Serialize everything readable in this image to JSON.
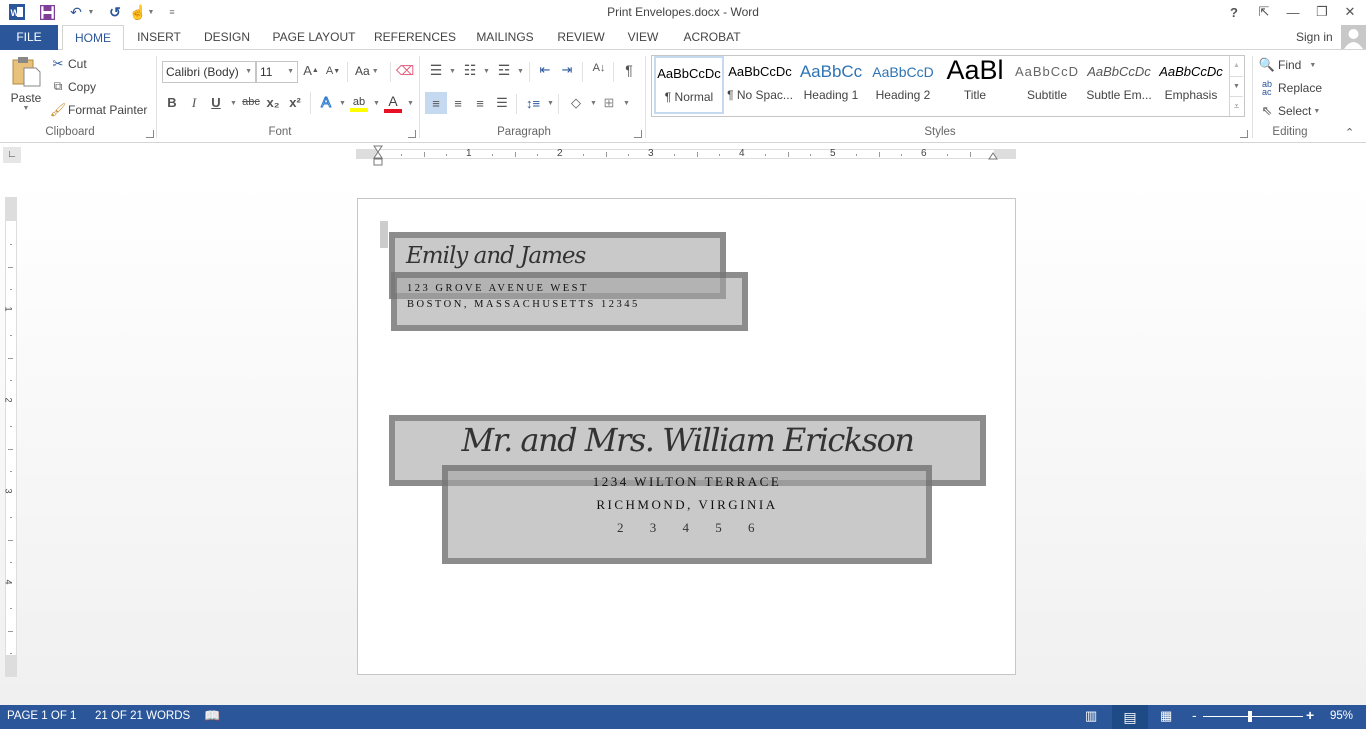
{
  "app": {
    "window_title": "Print Envelopes.docx - Word",
    "quick_access": {
      "word_icon": "word-logo-icon",
      "save": "save-icon",
      "undo": "undo-icon",
      "redo": "repeat-icon",
      "touch": "touch-mode-icon",
      "customize": "customize-quick-access-icon"
    },
    "window_controls": {
      "help": "?",
      "ribbon_display": "⇱",
      "minimize": "—",
      "restore": "❐",
      "close": "✕"
    }
  },
  "tabs": [
    {
      "label": "FILE"
    },
    {
      "label": "HOME",
      "active": true
    },
    {
      "label": "INSERT"
    },
    {
      "label": "DESIGN"
    },
    {
      "label": "PAGE LAYOUT"
    },
    {
      "label": "REFERENCES"
    },
    {
      "label": "MAILINGS"
    },
    {
      "label": "REVIEW"
    },
    {
      "label": "VIEW"
    },
    {
      "label": "ACROBAT"
    }
  ],
  "account": {
    "sign_in": "Sign in"
  },
  "ribbon": {
    "clipboard": {
      "label": "Clipboard",
      "paste": "Paste",
      "cut": "Cut",
      "copy": "Copy",
      "format_painter": "Format Painter"
    },
    "font": {
      "label": "Font",
      "font_name": "Calibri (Body)",
      "font_size": "11",
      "grow": "A",
      "shrink": "A",
      "change_case": "Aa",
      "bold": "B",
      "italic": "I",
      "underline": "U",
      "strikethrough": "abc",
      "subscript": "x₂",
      "superscript": "x²",
      "text_effects": "A",
      "highlight": "ab",
      "font_color": "A",
      "highlight_color": "#ffff00",
      "font_color_value": "#e81123"
    },
    "paragraph": {
      "label": "Paragraph",
      "pilcrow": "¶"
    },
    "styles": {
      "label": "Styles",
      "items": [
        {
          "preview": "AaBbCcDc",
          "label": "¶ Normal",
          "selected": true
        },
        {
          "preview": "AaBbCcDc",
          "label": "¶ No Spac..."
        },
        {
          "preview": "AaBbCc",
          "label": "Heading 1"
        },
        {
          "preview": "AaBbCcD",
          "label": "Heading 2"
        },
        {
          "preview": "AaBl",
          "label": "Title"
        },
        {
          "preview": "AaBbCcD",
          "label": "Subtitle"
        },
        {
          "preview": "AaBbCcDc",
          "label": "Subtle Em..."
        },
        {
          "preview": "AaBbCcDc",
          "label": "Emphasis"
        }
      ]
    },
    "editing": {
      "label": "Editing",
      "find": "Find",
      "replace": "Replace",
      "select": "Select"
    }
  },
  "ruler": {
    "numbers": [
      "1",
      "2",
      "3",
      "4",
      "5",
      "6"
    ],
    "vertical_numbers": [
      "1",
      "2",
      "3",
      "4"
    ]
  },
  "document": {
    "return_address": {
      "name": "Emily and James",
      "line1": "123 GROVE AVENUE WEST",
      "line2": "BOSTON, MASSACHUSETTS 12345"
    },
    "recipient": {
      "name": "Mr. and Mrs. William Erickson",
      "line1": "1234 WILTON TERRACE",
      "line2": "RICHMOND, VIRGINIA",
      "line3": "2 3 4 5 6"
    }
  },
  "status_bar": {
    "page": "PAGE 1 OF 1",
    "words": "21 OF 21 WORDS",
    "zoom": "95%",
    "zoom_percent": 95
  }
}
